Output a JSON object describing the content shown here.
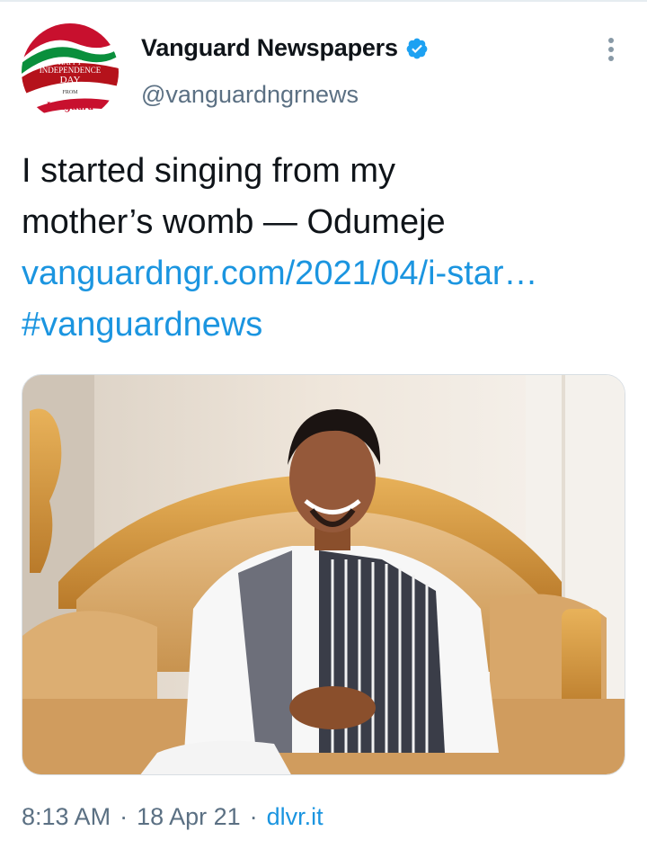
{
  "account": {
    "display_name": "Vanguard Newspapers",
    "handle": "@vanguardngrnews",
    "verified": true,
    "avatar_text": [
      "HAPPY",
      "INDEPENDENCE",
      "DAY",
      "FROM",
      "Vanguard"
    ]
  },
  "tweet": {
    "text_line1": "I started singing from my",
    "text_line2": "mother’s womb — Odumeje",
    "link": "vanguardngr.com/2021/04/i-star…",
    "hashtag": "#vanguardnews"
  },
  "meta": {
    "time": "8:13 AM",
    "date": "18 Apr 21",
    "source": "dlvr.it"
  },
  "icons": {
    "verified": "verified-badge-icon",
    "more": "more-options-icon"
  },
  "colors": {
    "link": "#1b95e0",
    "verified": "#1da1f2",
    "secondary_text": "#5b7083"
  }
}
